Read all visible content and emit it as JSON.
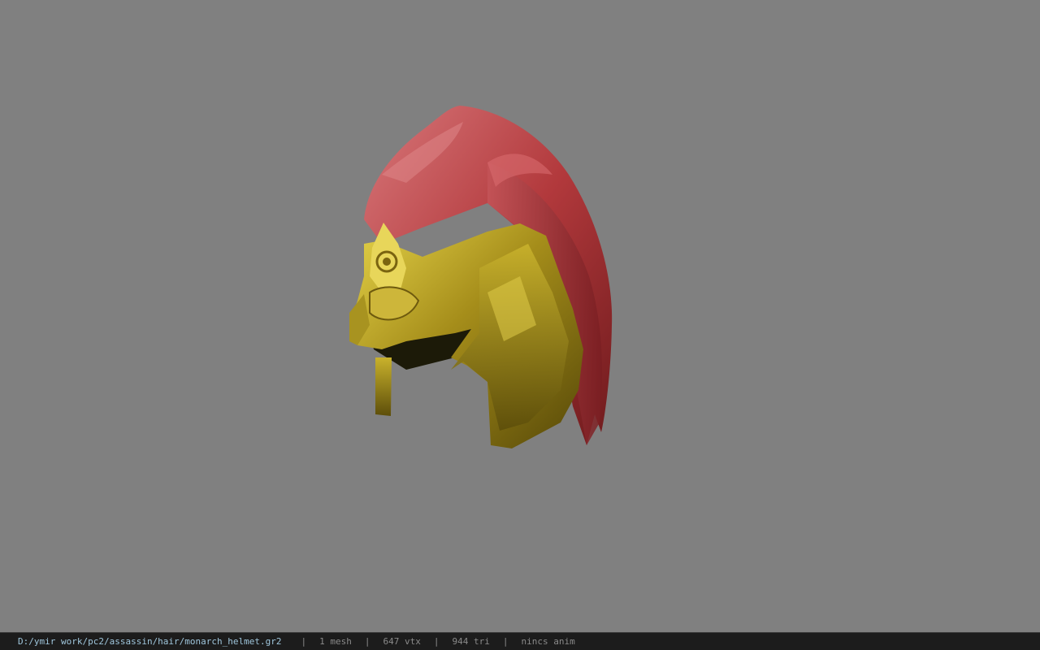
{
  "status_bar": {
    "file_path": "D:/ymir work/pc2/assassin/hair/monarch_helmet.gr2",
    "mesh_count": "1 mesh",
    "vertex_count": "647 vtx",
    "triangle_count": "944 tri",
    "animation": "nincs anim",
    "separator": "|"
  },
  "colors": {
    "viewport_background": "#808080",
    "statusbar_background": "#1c1c1c",
    "path_text": "#9fc6dc",
    "info_text": "#8a8a8a"
  }
}
